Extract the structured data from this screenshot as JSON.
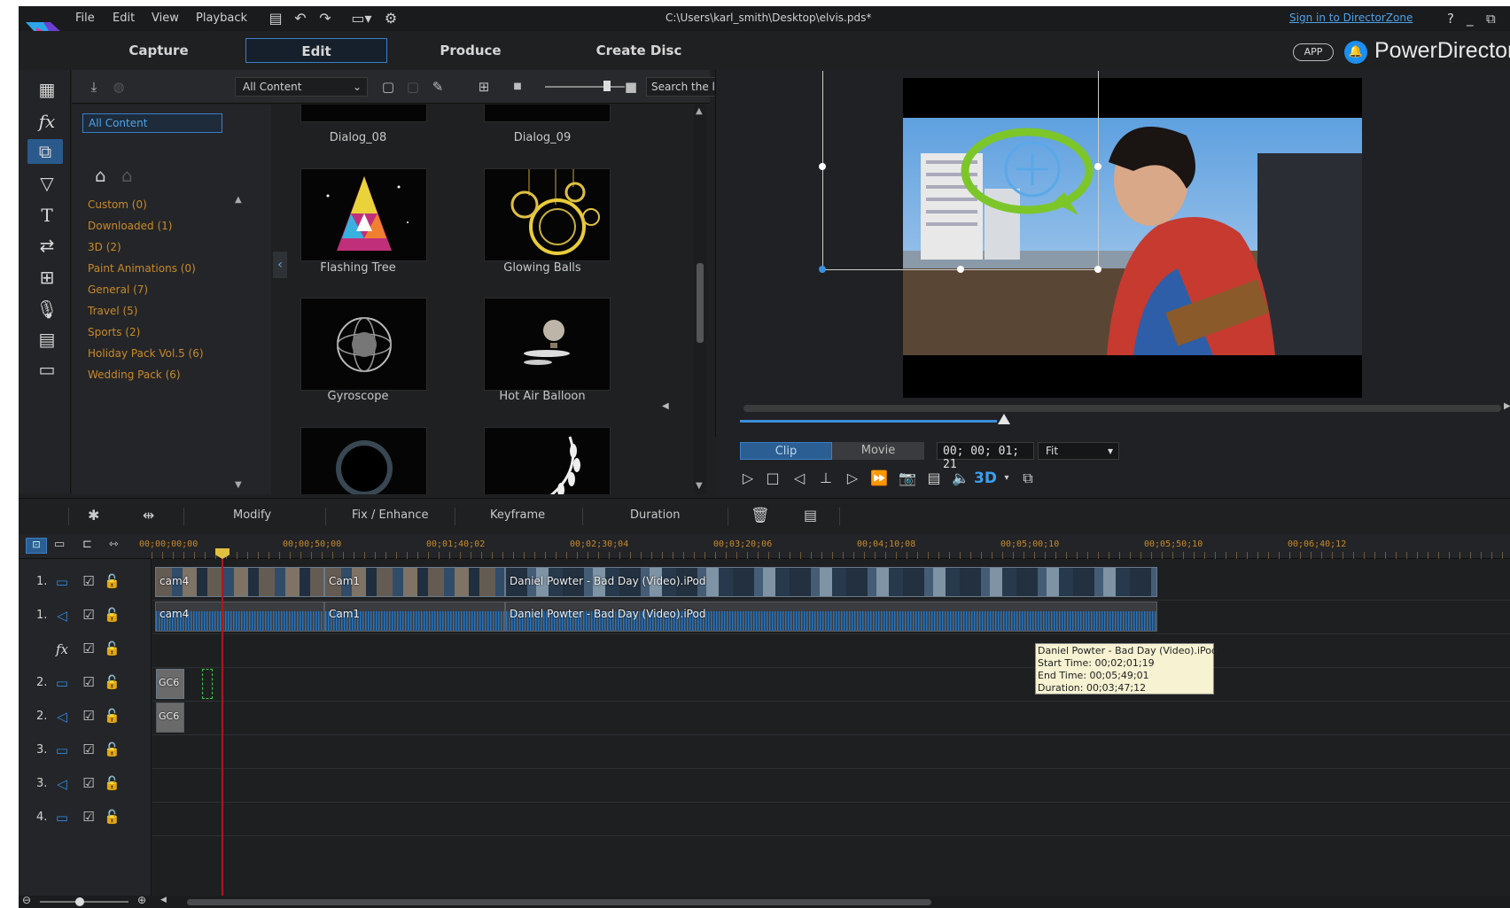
{
  "menu": [
    "File",
    "Edit",
    "View",
    "Playback"
  ],
  "file_path": "C:\\Users\\karl_smith\\Desktop\\elvis.pds*",
  "sign_in_link": "Sign in to DirectorZone",
  "window_controls": [
    "?",
    "_",
    "⧉"
  ],
  "mode_tabs": [
    "Capture",
    "Edit",
    "Produce",
    "Create Disc"
  ],
  "active_mode": "Edit",
  "app_badge": "APP",
  "brand": "PowerDirector",
  "library": {
    "filter_value": "All Content",
    "search_placeholder": "Search the library",
    "category_selected": "All Content",
    "categories": [
      "Custom (0)",
      "Downloaded (1)",
      "3D (2)",
      "Paint Animations (0)",
      "General (7)",
      "Travel (5)",
      "Sports (2)",
      "Holiday Pack Vol.5 (6)",
      "Wedding Pack (6)"
    ],
    "items": [
      "Dialog_08",
      "Dialog_09",
      "Flashing Tree",
      "Glowing Balls",
      "Gyroscope",
      "Hot Air Balloon",
      "",
      ""
    ]
  },
  "preview": {
    "tab_clip": "Clip",
    "tab_movie": "Movie",
    "timecode": "00; 00; 01; 21",
    "fit_value": "Fit",
    "three_d": "3D",
    "scrub_progress": 0.33
  },
  "edit_toolbar": [
    "Modify",
    "Fix / Enhance",
    "Keyframe",
    "Duration"
  ],
  "ruler": [
    "00;00;00;00",
    "00;00;50;00",
    "00;01;40;02",
    "00;02;30;04",
    "00;03;20;06",
    "00;04;10;08",
    "00;05;00;10",
    "00;05;50;10",
    "00;06;40;12"
  ],
  "tracks": [
    {
      "num": "1.",
      "kind": "video"
    },
    {
      "num": "1.",
      "kind": "audio"
    },
    {
      "num": "",
      "kind": "fx"
    },
    {
      "num": "2.",
      "kind": "video"
    },
    {
      "num": "2.",
      "kind": "audio"
    },
    {
      "num": "3.",
      "kind": "video"
    },
    {
      "num": "3.",
      "kind": "audio"
    },
    {
      "num": "4.",
      "kind": "video"
    }
  ],
  "clips": {
    "video1": [
      "cam4",
      "Cam1",
      "Daniel Powter - Bad Day (Video).iPod"
    ],
    "audio1": [
      "cam4",
      "Cam1",
      "Daniel Powter - Bad Day (Video).iPod"
    ],
    "video2": [
      "GC6"
    ],
    "audio2": [
      "GC6"
    ]
  },
  "tooltip": {
    "title": "Daniel Powter - Bad Day (Video).iPod",
    "start": "Start Time: 00;02;01;19",
    "end": "End Time: 00;05;49;01",
    "duration": "Duration: 00;03;47;12"
  },
  "colors": {
    "accent": "#3a7fc8",
    "category_text": "#c88a28",
    "playhead": "#b01818"
  }
}
